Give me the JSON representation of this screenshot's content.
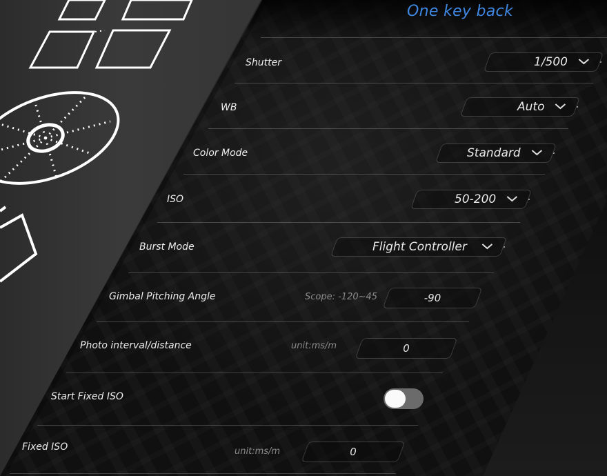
{
  "header": {
    "title": "One key back"
  },
  "settings": {
    "shutter": {
      "label": "Shutter",
      "value": "1/500"
    },
    "wb": {
      "label": "WB",
      "value": "Auto"
    },
    "color_mode": {
      "label": "Color Mode",
      "value": "Standard"
    },
    "iso": {
      "label": "ISO",
      "value": "50-200"
    },
    "burst_mode": {
      "label": "Burst Mode",
      "value": "Flight Controller"
    },
    "gimbal": {
      "label": "Gimbal Pitching Angle",
      "hint": "Scope: -120~45",
      "value": "-90"
    },
    "photo_interval": {
      "label": "Photo interval/distance",
      "hint": "unit:ms/m",
      "value": "0"
    },
    "start_fixed_iso": {
      "label": "Start Fixed ISO",
      "enabled": false
    },
    "fixed_iso": {
      "label": "Fixed ISO",
      "hint": "unit:ms/m",
      "value": "0"
    }
  },
  "icons": [
    "grid-mode-icon",
    "orbit-mode-icon",
    "chevron-down-icon"
  ],
  "colors": {
    "accent": "#3f86e0",
    "text": "#ededed",
    "hint": "#8a8a8a"
  }
}
